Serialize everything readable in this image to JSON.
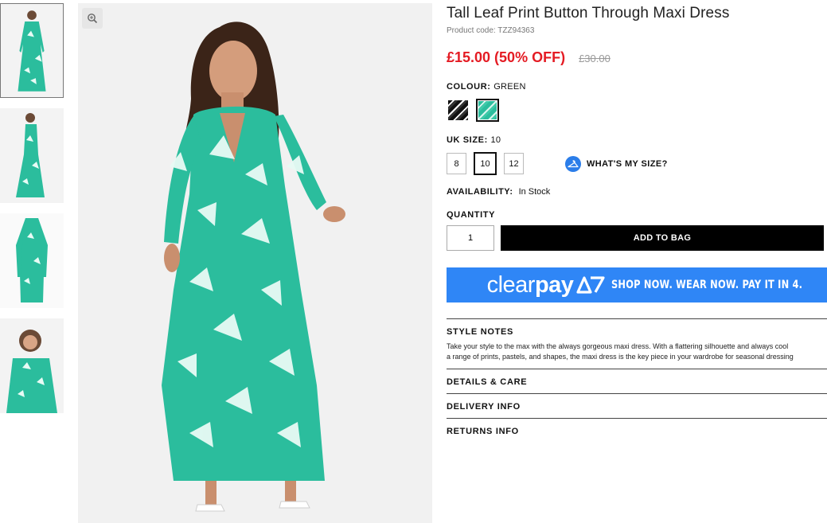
{
  "product": {
    "title": "Tall Leaf Print Button Through Maxi Dress",
    "code": "Product code: TZZ94363",
    "price": "£15.00 (50% OFF)",
    "was_price": "£30.00"
  },
  "colour": {
    "label": "COLOUR:",
    "value": "GREEN",
    "swatches": [
      "black-print-swatch",
      "green-print-swatch"
    ],
    "selected": "green"
  },
  "size": {
    "label": "UK SIZE:",
    "value": "10",
    "options": [
      "8",
      "10",
      "12"
    ],
    "help": "WHAT'S MY SIZE?"
  },
  "availability": {
    "label": "AVAILABILITY:",
    "value": "In Stock"
  },
  "quantity": {
    "label": "QUANTITY",
    "value": "1"
  },
  "add_to_bag": "ADD TO BAG",
  "clearpay": {
    "brand_light": "clear",
    "brand_bold": "pay",
    "slogan": "SHOP NOW. WEAR NOW. PAY IT IN 4.",
    "color": "#2f86f6"
  },
  "accordion": {
    "style_notes": {
      "title": "STYLE NOTES",
      "line1": "Take your style to the max with the always gorgeous maxi dress. With a flattering silhouette and always cool",
      "line2": "a range of prints, pastels, and shapes, the maxi dress is the key piece in your wardrobe for seasonal dressing"
    },
    "details": "DETAILS & CARE",
    "delivery": "DELIVERY INFO",
    "returns": "RETURNS INFO"
  },
  "colors": {
    "sale_red": "#e41b23",
    "dress_green": "#2bbd9d",
    "button_black": "#000000"
  }
}
